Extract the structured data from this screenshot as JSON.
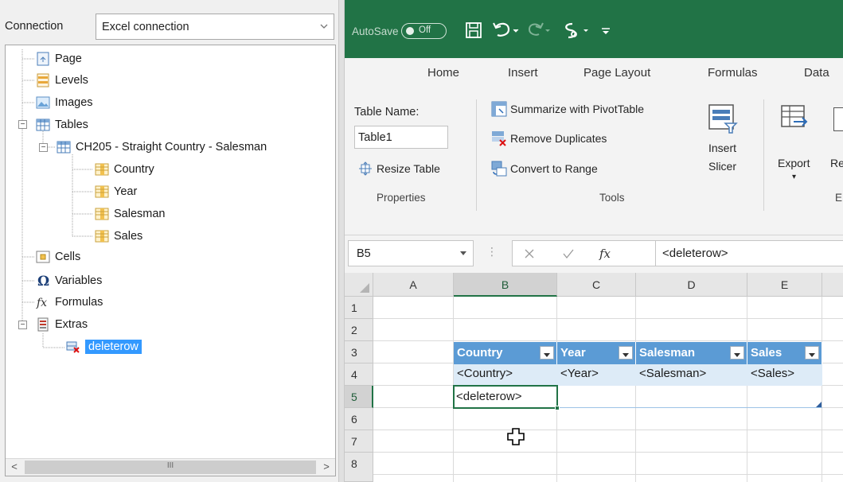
{
  "left_panel": {
    "connection_label": "Connection",
    "connection_value": "Excel connection",
    "tree": [
      {
        "label": "Page",
        "icon": "page-icon"
      },
      {
        "label": "Levels",
        "icon": "levels-icon"
      },
      {
        "label": "Images",
        "icon": "images-icon"
      },
      {
        "label": "Tables",
        "icon": "tables-icon"
      },
      {
        "label": "CH205 - Straight Country - Salesman",
        "icon": "table-icon"
      },
      {
        "label": "Country",
        "icon": "column-icon"
      },
      {
        "label": "Year",
        "icon": "column-icon"
      },
      {
        "label": "Salesman",
        "icon": "column-icon"
      },
      {
        "label": "Sales",
        "icon": "column-icon"
      },
      {
        "label": "Cells",
        "icon": "cells-icon"
      },
      {
        "label": "Variables",
        "icon": "omega-icon"
      },
      {
        "label": "Formulas",
        "icon": "fx-icon"
      },
      {
        "label": "Extras",
        "icon": "extras-icon"
      },
      {
        "label": "deleterow",
        "icon": "deleterow-icon"
      }
    ],
    "scroll_grip": "III"
  },
  "excel": {
    "autosave_label": "AutoSave",
    "autosave_state": "Off",
    "tabs": [
      "Home",
      "Insert",
      "Page Layout",
      "Formulas",
      "Data"
    ],
    "ribbon": {
      "table_name_label": "Table Name:",
      "table_name_value": "Table1",
      "resize_table": "Resize Table",
      "properties_group": "Properties",
      "summarize": "Summarize with PivotTable",
      "remove_duplicates": "Remove Duplicates",
      "convert_range": "Convert to Range",
      "tools_group": "Tools",
      "insert_slicer_1": "Insert",
      "insert_slicer_2": "Slicer",
      "export": "Export",
      "refresh_partial": "Re",
      "ext_group_partial": "E"
    },
    "name_box": "B5",
    "fx_symbol": "fx",
    "formula_value": "<deleterow>",
    "columns": [
      "A",
      "B",
      "C",
      "D",
      "E"
    ],
    "rows": [
      "1",
      "2",
      "3",
      "4",
      "5",
      "6",
      "7",
      "8"
    ],
    "table_headers": [
      "Country",
      "Year",
      "Salesman",
      "Sales"
    ],
    "table_row": [
      "<Country>",
      "<Year>",
      "<Salesman>",
      "<Sales>"
    ],
    "active_cell_value": "<deleterow>"
  },
  "colors": {
    "excel_green": "#217346",
    "table_header_blue": "#5b9bd5",
    "table_row_blue": "#ddebf7",
    "tree_selection": "#3399ff"
  }
}
